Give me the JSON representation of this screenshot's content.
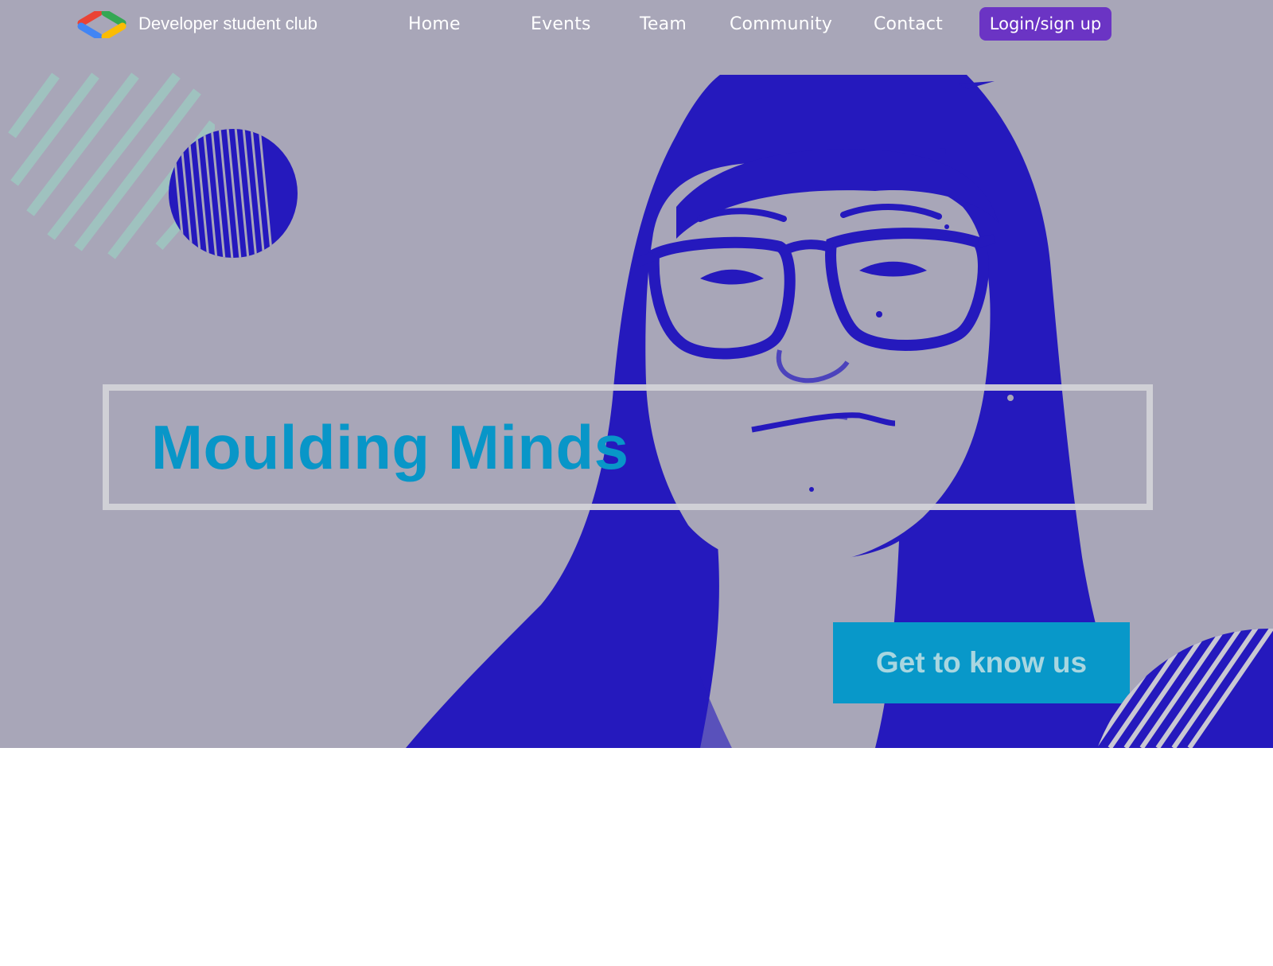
{
  "brand": {
    "name": "Developer student club",
    "logo_icon": "dsc-logo-icon"
  },
  "nav": {
    "home": "Home",
    "events": "Events",
    "team": "Team",
    "community": "Community",
    "contact": "Contact",
    "login": "Login/sign up"
  },
  "hero": {
    "headline": "Moulding Minds",
    "cta": "Get to know us"
  },
  "colors": {
    "hero_bg": "#a8a6b8",
    "portrait_blue": "#2519bd",
    "headline": "#0896c8",
    "cta_bg": "#0898c9",
    "login_bg": "#6b34c4"
  }
}
